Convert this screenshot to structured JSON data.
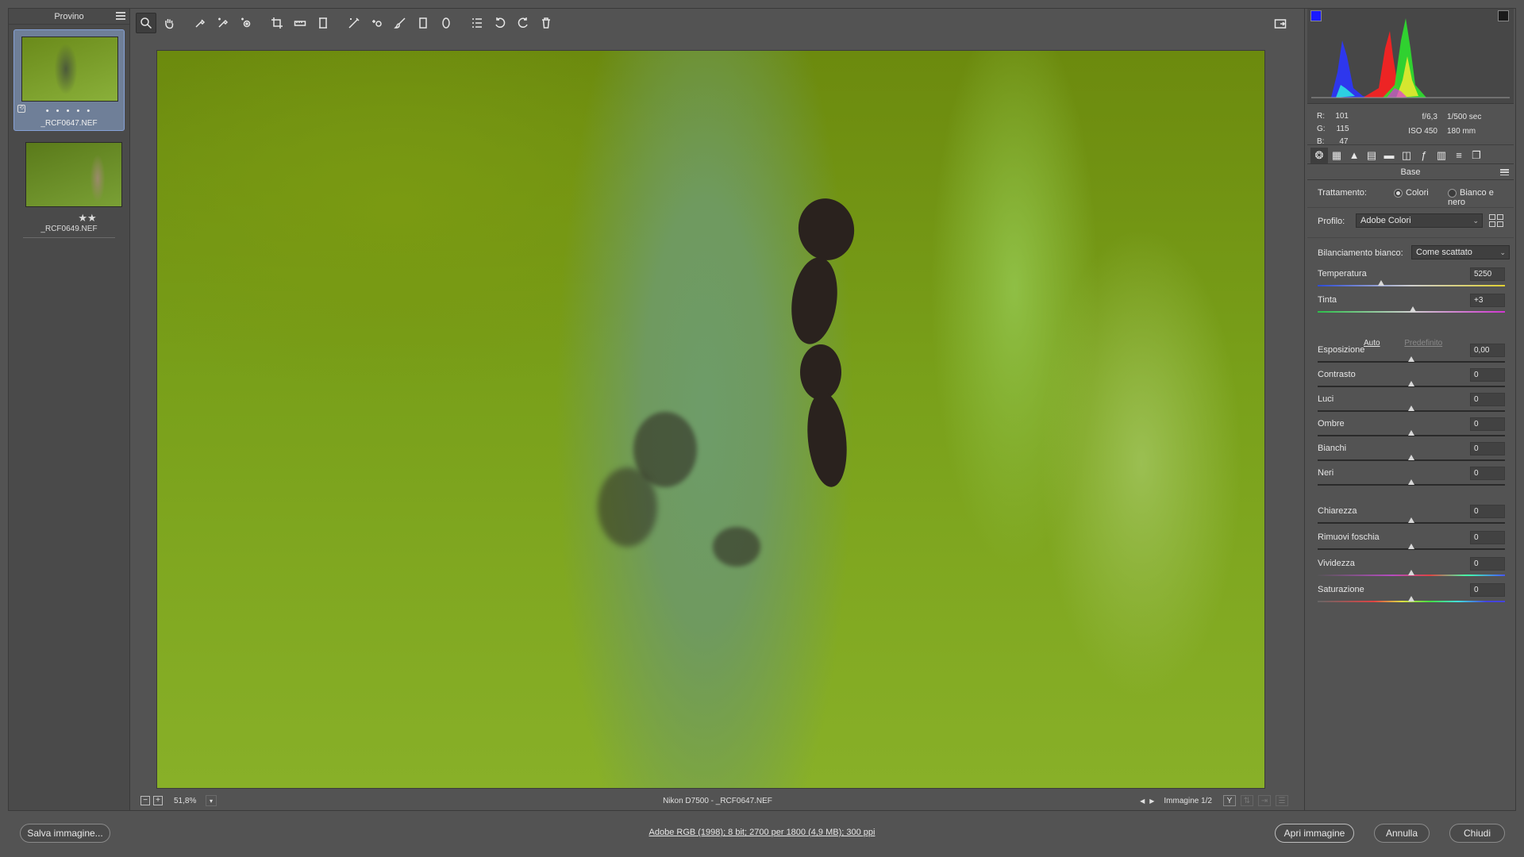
{
  "filmstrip": {
    "title": "Provino",
    "items": [
      {
        "name": "_RCF0647.NEF",
        "stars": "• • • • •",
        "badge": "⟲"
      },
      {
        "name": "_RCF0649.NEF",
        "stars": "★★"
      }
    ]
  },
  "toolbar": {
    "tools": [
      "zoom-icon",
      "hand-icon",
      "white-balance-icon",
      "color-sampler-icon",
      "targeted-adjust-icon",
      "crop-icon",
      "straighten-icon",
      "transform-icon",
      "spot-removal-icon",
      "red-eye-icon",
      "adjustment-brush-icon",
      "graduated-filter-icon",
      "radial-filter-icon",
      "preferences-icon",
      "rotate-left-icon",
      "rotate-right-icon",
      "trash-icon"
    ],
    "right_tool": "fullscreen-icon"
  },
  "status": {
    "zoom": "51,8%",
    "camera_file": "Nikon D7500  -  _RCF0647.NEF",
    "image_counter": "Immagine 1/2",
    "y_button": "Y"
  },
  "histogram": {
    "rgb": {
      "r_label": "R:",
      "r": "101",
      "g_label": "G:",
      "g": "115",
      "b_label": "B:",
      "b": "47"
    },
    "exif": {
      "aperture": "f/6,3",
      "shutter": "1/500 sec",
      "iso": "ISO 450",
      "focal": "180 mm"
    }
  },
  "panel": {
    "title": "Base",
    "trattamento_label": "Trattamento:",
    "colori": "Colori",
    "bn": "Bianco e nero",
    "profilo_label": "Profilo:",
    "profilo_value": "Adobe Colori",
    "wb_label": "Bilanciamento bianco:",
    "wb_value": "Come scattato",
    "auto": "Auto",
    "default": "Predefinito",
    "sliders": [
      {
        "label": "Temperatura",
        "value": "5250",
        "pos": 0.34
      },
      {
        "label": "Tinta",
        "value": "+3",
        "pos": 0.51
      },
      {
        "label": "Esposizione",
        "value": "0,00",
        "pos": 0.5
      },
      {
        "label": "Contrasto",
        "value": "0",
        "pos": 0.5
      },
      {
        "label": "Luci",
        "value": "0",
        "pos": 0.5
      },
      {
        "label": "Ombre",
        "value": "0",
        "pos": 0.5
      },
      {
        "label": "Bianchi",
        "value": "0",
        "pos": 0.5
      },
      {
        "label": "Neri",
        "value": "0",
        "pos": 0.5
      },
      {
        "label": "Chiarezza",
        "value": "0",
        "pos": 0.5
      },
      {
        "label": "Rimuovi foschia",
        "value": "0",
        "pos": 0.5
      },
      {
        "label": "Vividezza",
        "value": "0",
        "pos": 0.5
      },
      {
        "label": "Saturazione",
        "value": "0",
        "pos": 0.5
      }
    ]
  },
  "bottom": {
    "save": "Salva immagine...",
    "info": "Adobe RGB (1998); 8 bit; 2700 per 1800 (4,9 MB); 300 ppi",
    "open": "Apri immagine",
    "cancel": "Annulla",
    "close": "Chiudi"
  }
}
